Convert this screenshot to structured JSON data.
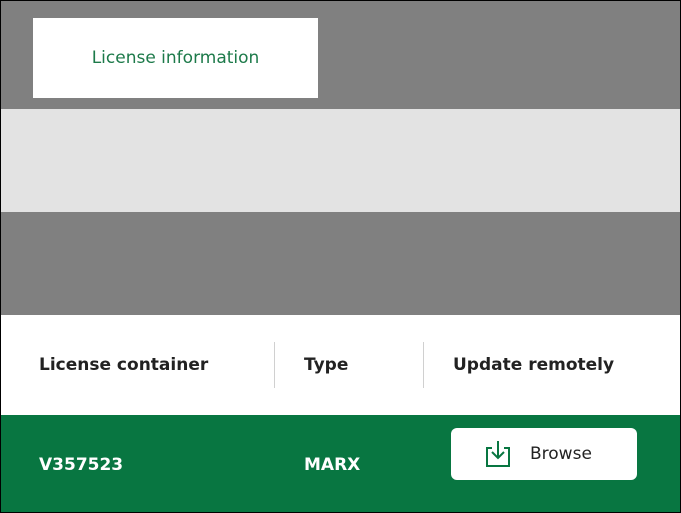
{
  "tabs": [
    {
      "label": "License information",
      "active": true
    }
  ],
  "table": {
    "columns": [
      {
        "key": "container",
        "label": "License container"
      },
      {
        "key": "type",
        "label": "Type"
      },
      {
        "key": "update",
        "label": "Update remotely"
      }
    ],
    "rows": [
      {
        "container": "V357523",
        "type": "MARX",
        "update_button_label": "Browse",
        "update_button_icon": "download-to-tray-icon",
        "selected": true
      }
    ]
  },
  "colors": {
    "accent": "#087641",
    "tab_text": "#1d7a4a",
    "band_dark": "#808080",
    "band_light": "#e3e3e3"
  }
}
